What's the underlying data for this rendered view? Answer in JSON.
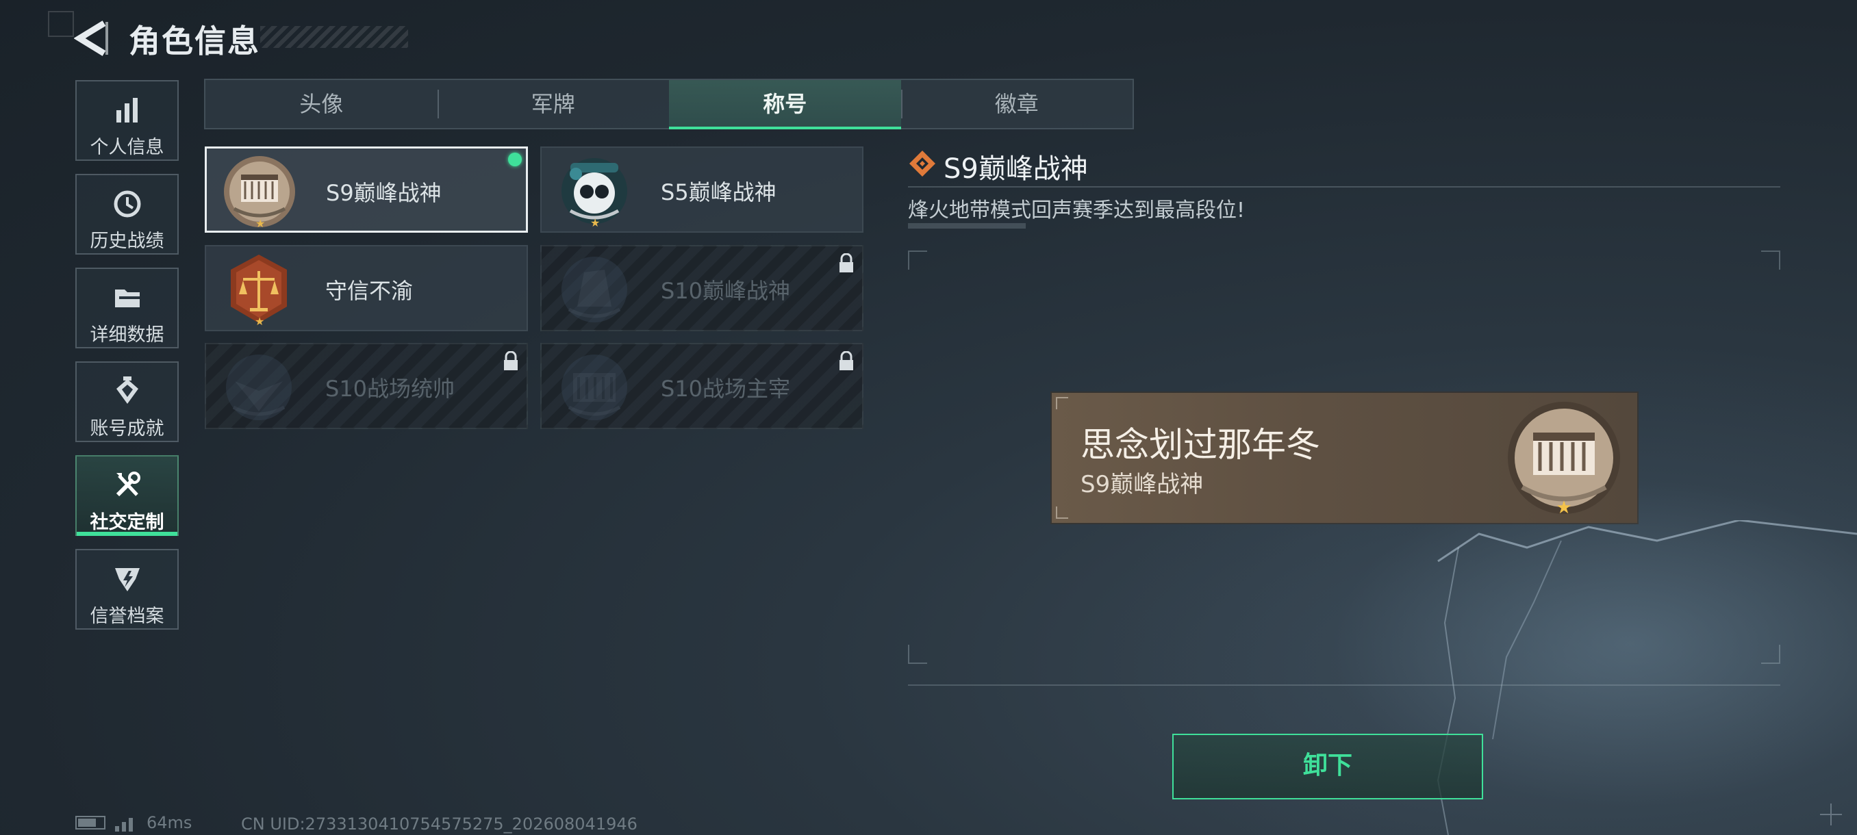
{
  "header": {
    "title": "角色信息"
  },
  "sidebar": {
    "items": [
      {
        "label": "个人信息",
        "icon": "bar-chart-icon"
      },
      {
        "label": "历史战绩",
        "icon": "clock-icon"
      },
      {
        "label": "详细数据",
        "icon": "folder-icon"
      },
      {
        "label": "账号成就",
        "icon": "medal-icon"
      },
      {
        "label": "社交定制",
        "icon": "tools-icon",
        "active": true
      },
      {
        "label": "信誉档案",
        "icon": "shield-icon"
      }
    ]
  },
  "tabs": [
    {
      "label": "头像"
    },
    {
      "label": "军牌"
    },
    {
      "label": "称号",
      "active": true
    },
    {
      "label": "徽章"
    }
  ],
  "titles": [
    {
      "name": "S9巅峰战神",
      "selected": true,
      "equipped": true,
      "locked": false
    },
    {
      "name": "S5巅峰战神",
      "selected": false,
      "equipped": false,
      "locked": false
    },
    {
      "name": "守信不渝",
      "selected": false,
      "equipped": false,
      "locked": false
    },
    {
      "name": "S10巅峰战神",
      "selected": false,
      "equipped": false,
      "locked": true
    },
    {
      "name": "S10战场统帅",
      "selected": false,
      "equipped": false,
      "locked": true
    },
    {
      "name": "S10战场主宰",
      "selected": false,
      "equipped": false,
      "locked": true
    }
  ],
  "detail": {
    "title": "S9巅峰战神",
    "description": "烽火地带模式回声赛季达到最高段位!"
  },
  "nameplate": {
    "player_name": "思念划过那年冬",
    "title": "S9巅峰战神"
  },
  "actions": {
    "unequip_label": "卸下"
  },
  "status": {
    "ping": "64ms",
    "uid": "CN UID:2733130410754575275_202608041946"
  },
  "colors": {
    "accent": "#3fe09a",
    "star": "#e8b84d",
    "nameplate": "#5e5042"
  }
}
